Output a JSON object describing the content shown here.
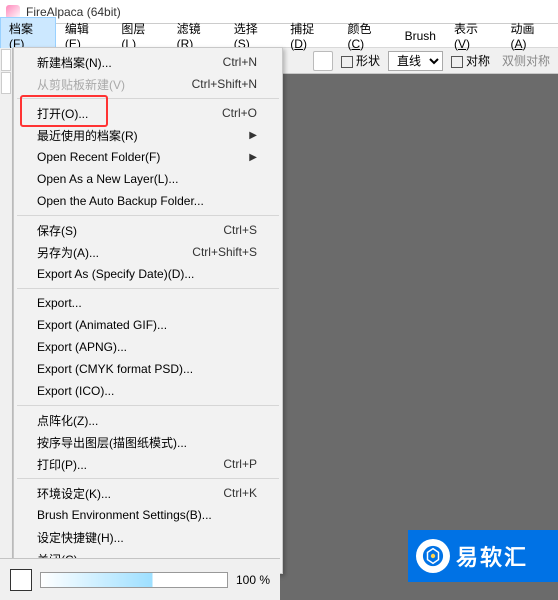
{
  "title": "FireAlpaca (64bit)",
  "menubar": [
    {
      "label": "档案",
      "key": "F"
    },
    {
      "label": "编辑",
      "key": "E"
    },
    {
      "label": "图层",
      "key": "L"
    },
    {
      "label": "滤镜",
      "key": "R"
    },
    {
      "label": "选择",
      "key": "S"
    },
    {
      "label": "捕捉",
      "key": "D"
    },
    {
      "label": "颜色",
      "key": "C"
    },
    {
      "label": "Brush",
      "key": ""
    },
    {
      "label": "表示",
      "key": "V"
    },
    {
      "label": "动画",
      "key": "A"
    }
  ],
  "toolbar": {
    "shape_label": "形状",
    "shape_value": "直线",
    "sym_label": "对称",
    "sym_mode": "双侧对称"
  },
  "dropdown": {
    "new_file": "新建档案(N)...",
    "new_file_sc": "Ctrl+N",
    "new_clip": "从剪贴板新建(V)",
    "new_clip_sc": "Ctrl+Shift+N",
    "open": "打开(O)...",
    "open_sc": "Ctrl+O",
    "recent": "最近使用的档案(R)",
    "recent_folder": "Open Recent Folder(F)",
    "open_layer": "Open As a New Layer(L)...",
    "open_backup": "Open the Auto Backup Folder...",
    "save": "保存(S)",
    "save_sc": "Ctrl+S",
    "save_as": "另存为(A)...",
    "save_as_sc": "Ctrl+Shift+S",
    "export_date": "Export As (Specify Date)(D)...",
    "export": "Export...",
    "export_gif": "Export (Animated GIF)...",
    "export_apng": "Export (APNG)...",
    "export_cmyk": "Export (CMYK format PSD)...",
    "export_ico": "Export (ICO)...",
    "rasterize": "点阵化(Z)...",
    "export_layers": "按序导出图层(描图纸模式)...",
    "print": "打印(P)...",
    "print_sc": "Ctrl+P",
    "env": "环境设定(K)...",
    "env_sc": "Ctrl+K",
    "brush_env": "Brush Environment Settings(B)...",
    "shortcuts": "设定快捷键(H)...",
    "close": "关闭(C)"
  },
  "footer": {
    "zoom": "100 %"
  },
  "logo": "易软汇"
}
